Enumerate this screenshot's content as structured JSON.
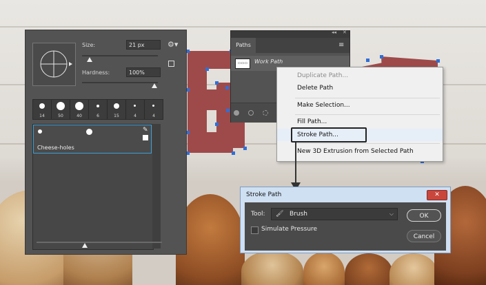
{
  "brush_panel": {
    "size_label": "Size:",
    "size_value": "21 px",
    "hardness_label": "Hardness:",
    "hardness_value": "100%",
    "gear_icon": "gear-icon",
    "presets": [
      {
        "num": "14"
      },
      {
        "num": "50"
      },
      {
        "num": "40"
      },
      {
        "num": "6"
      },
      {
        "num": "15"
      },
      {
        "num": "4"
      },
      {
        "num": "4"
      }
    ],
    "selected_brush": "Cheese-holes"
  },
  "paths_panel": {
    "tab": "Paths",
    "row_label": "Work Path"
  },
  "context_menu": {
    "items": [
      {
        "label": "Duplicate Path...",
        "disabled": true
      },
      {
        "label": "Delete Path",
        "disabled": false
      },
      {
        "label": "Make Selection...",
        "disabled": false
      },
      {
        "label": "Fill Path...",
        "disabled": false
      },
      {
        "label": "Stroke Path...",
        "disabled": false
      },
      {
        "label": "New 3D Extrusion from Selected Path",
        "disabled": false
      }
    ]
  },
  "stroke_dialog": {
    "title": "Stroke Path",
    "tool_label": "Tool:",
    "tool_value": "Brush",
    "simulate_label": "Simulate Pressure",
    "simulate_checked": false,
    "ok_label": "OK",
    "cancel_label": "Cancel",
    "close_label": "✕"
  },
  "colors": {
    "letter_red": "#9e4a4a",
    "path_anchor": "#2f6fd6",
    "panel_bg": "#535353"
  }
}
